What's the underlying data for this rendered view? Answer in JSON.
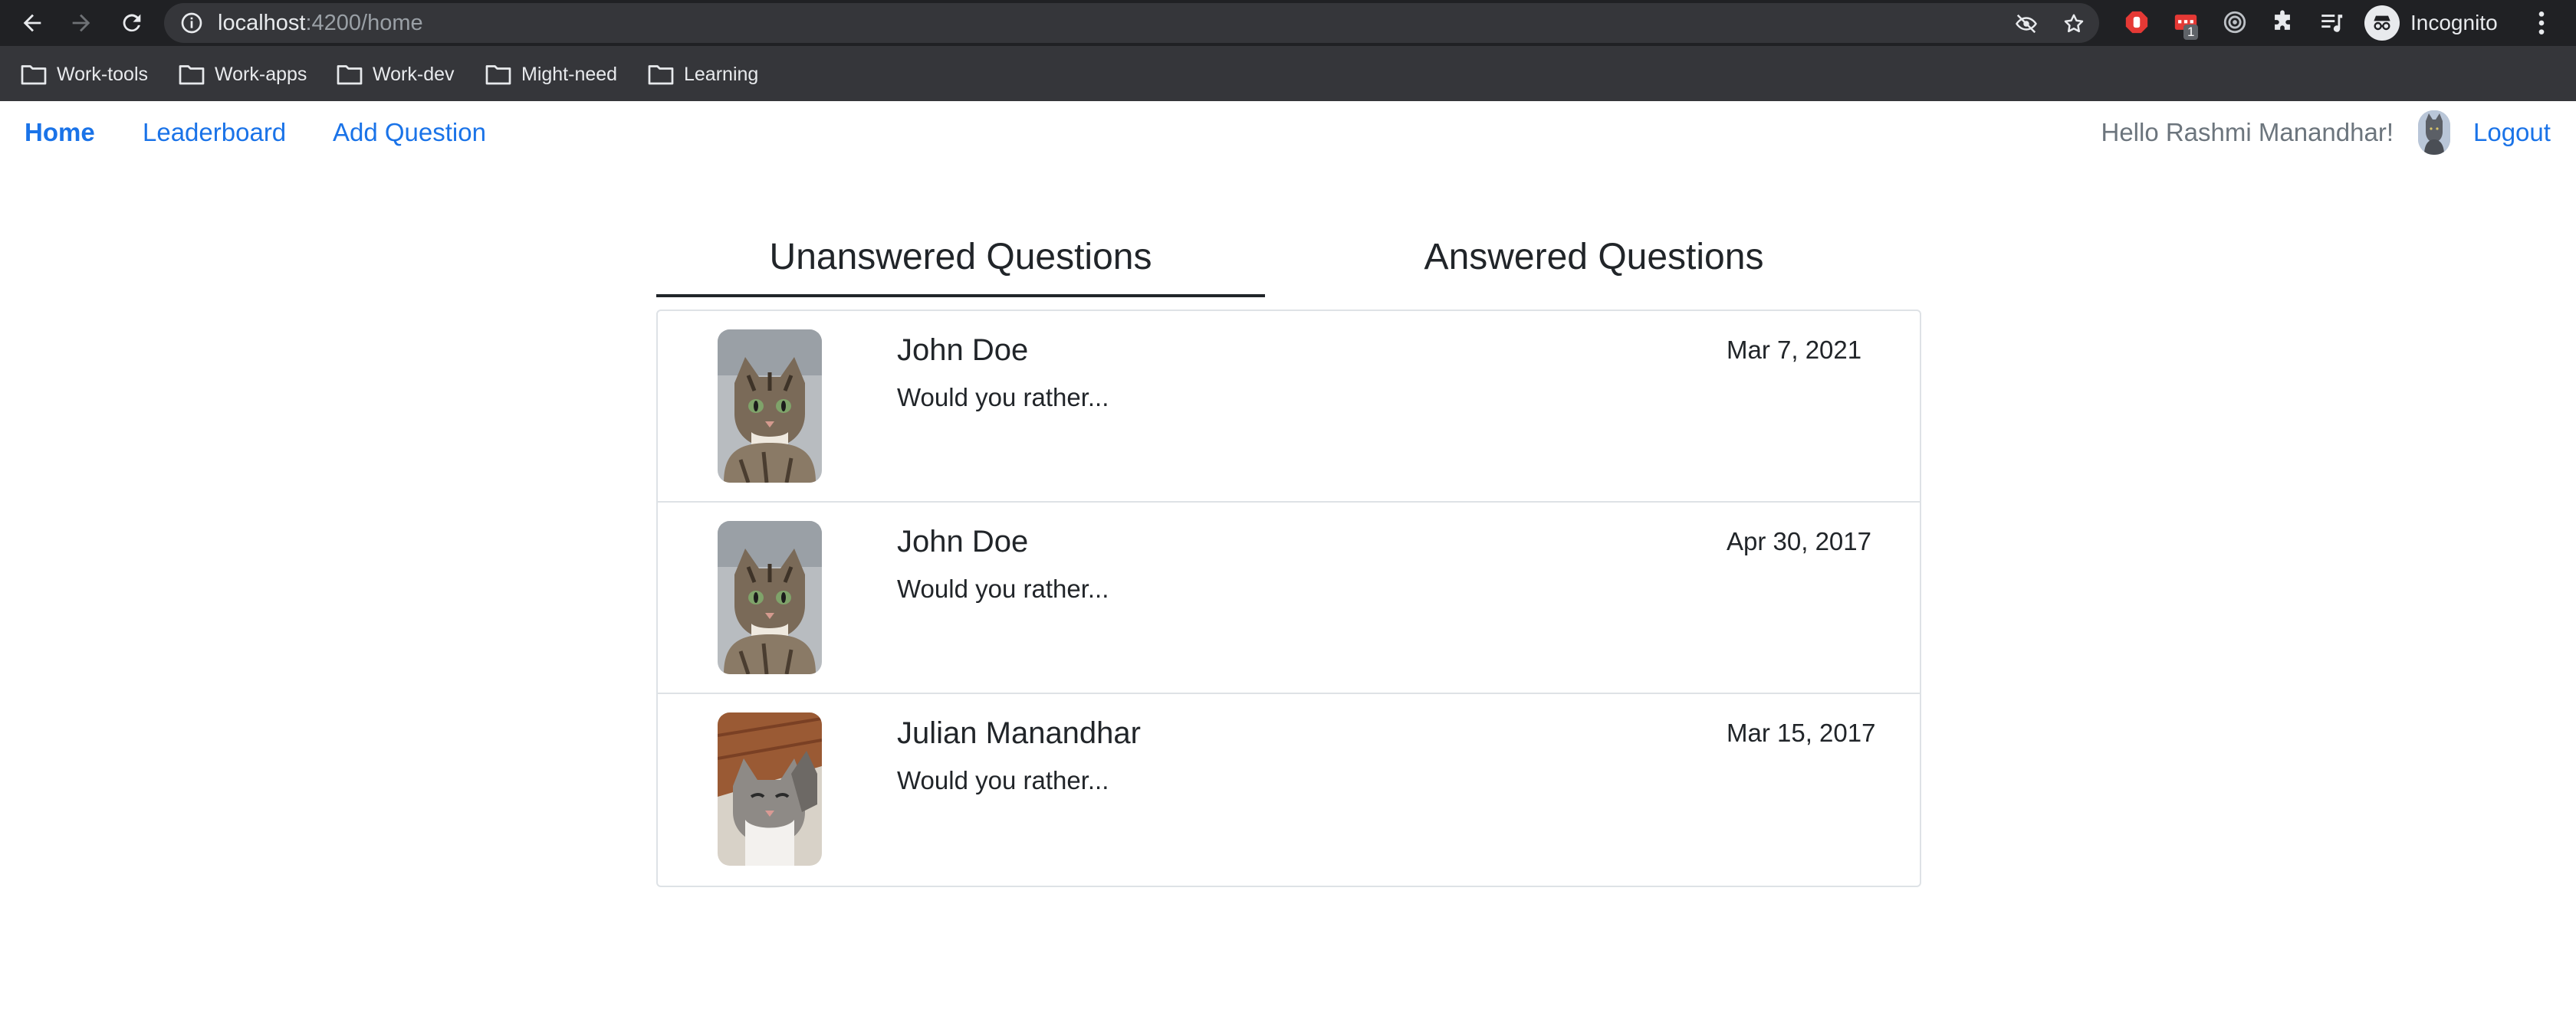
{
  "browser": {
    "url_host": "localhost",
    "url_path": ":4200/home",
    "incognito_label": "Incognito",
    "extension_badge": "1",
    "bookmarks": [
      "Work-tools",
      "Work-apps",
      "Work-dev",
      "Might-need",
      "Learning"
    ]
  },
  "nav": {
    "home": "Home",
    "leaderboard": "Leaderboard",
    "add_question": "Add Question",
    "greeting": "Hello Rashmi Manandhar!",
    "logout": "Logout"
  },
  "tabs": {
    "unanswered": "Unanswered Questions",
    "answered": "Answered Questions",
    "active": "unanswered"
  },
  "questions": [
    {
      "author": "John Doe",
      "text": "Would you rather...",
      "date": "Mar 7, 2021",
      "avatar": "tabby-kitten"
    },
    {
      "author": "John Doe",
      "text": "Would you rather...",
      "date": "Apr 30, 2017",
      "avatar": "tabby-kitten"
    },
    {
      "author": "Julian Manandhar",
      "text": "Would you rather...",
      "date": "Mar 15, 2017",
      "avatar": "sleeping-kitten"
    }
  ],
  "colors": {
    "link": "#1a73e8",
    "chrome_dark": "#202124",
    "bookmark_bar": "#35363a",
    "border": "#dee2e6"
  }
}
